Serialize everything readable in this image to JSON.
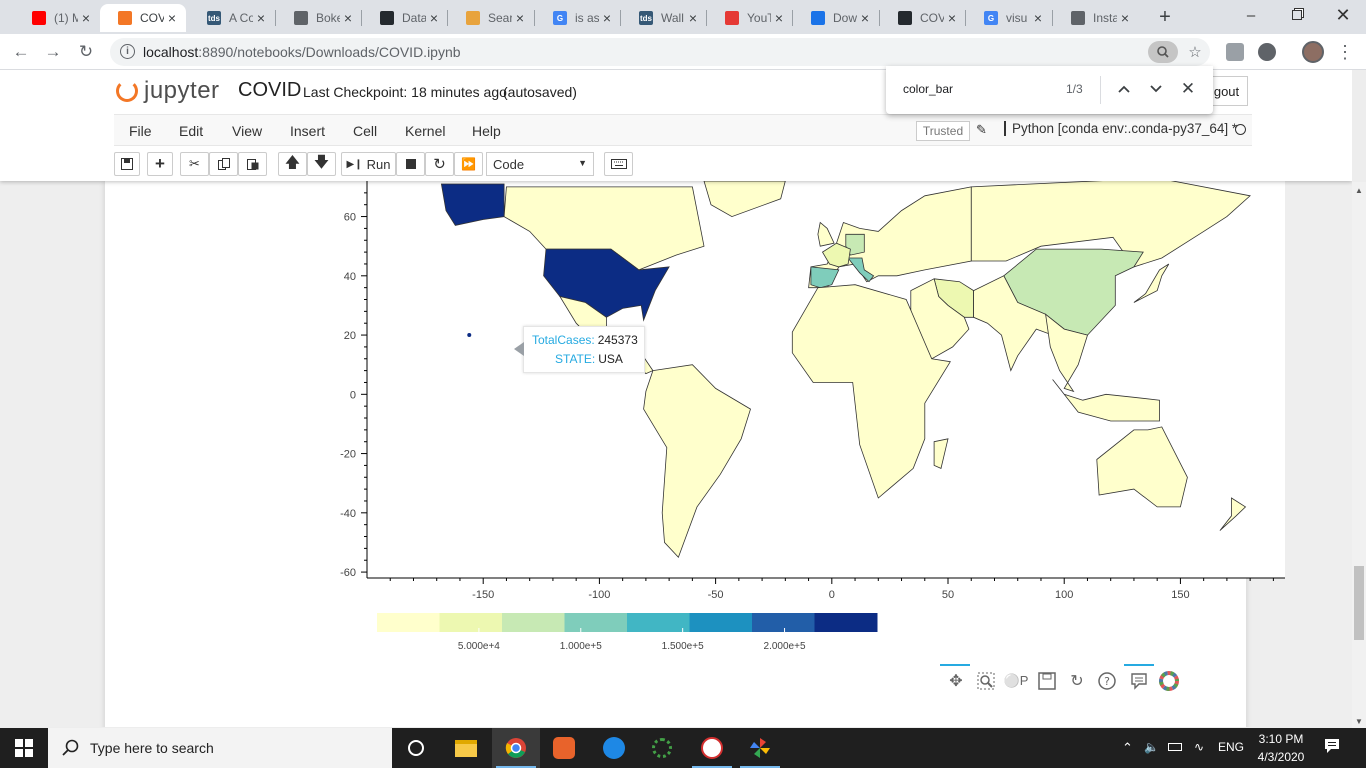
{
  "browser": {
    "tabs": [
      {
        "title": "(1) M",
        "favicon": "youtube-icon",
        "color": "#ff0000"
      },
      {
        "title": "COV",
        "favicon": "jupyter-icon",
        "color": "#f37726",
        "active": true
      },
      {
        "title": "A Co",
        "favicon": "tds-icon",
        "color": "#355876",
        "glyph": "tds"
      },
      {
        "title": "Boke",
        "favicon": "globe-icon",
        "color": "#5f6368"
      },
      {
        "title": "Data",
        "favicon": "github-icon",
        "color": "#24292e"
      },
      {
        "title": "Sear",
        "favicon": "pinwheel-icon",
        "color": "#e8a33d"
      },
      {
        "title": "is as",
        "favicon": "google-icon",
        "color": "#4285f4",
        "glyph": "G"
      },
      {
        "title": "Wall",
        "favicon": "tds-icon",
        "color": "#355876",
        "glyph": "tds"
      },
      {
        "title": "YouT",
        "favicon": "youtube-download-icon",
        "color": "#e53935"
      },
      {
        "title": "Dow",
        "favicon": "download-icon",
        "color": "#1a73e8"
      },
      {
        "title": "COV",
        "favicon": "github-icon",
        "color": "#24292e"
      },
      {
        "title": "visu",
        "favicon": "google-icon",
        "color": "#4285f4",
        "glyph": "G"
      },
      {
        "title": "Insta",
        "favicon": "globe-icon",
        "color": "#5f6368"
      }
    ],
    "url_host": "localhost",
    "url_path": ":8890/notebooks/Downloads/COVID.ipynb"
  },
  "find": {
    "query": "color_bar",
    "count": "1/3"
  },
  "jupyter": {
    "logo_text": "jupyter",
    "notebook_name": "COVID",
    "checkpoint": "Last Checkpoint: 18 minutes ago",
    "autosaved": "(autosaved)",
    "logout": "gout",
    "menus": [
      "File",
      "Edit",
      "View",
      "Insert",
      "Cell",
      "Kernel",
      "Help"
    ],
    "trusted": "Trusted",
    "kernel": "Python [conda env:.conda-py37_64] *",
    "run_label": "Run",
    "cell_type": "Code"
  },
  "tooltip": {
    "rows": [
      {
        "key": "TotalCases:",
        "value": "245373"
      },
      {
        "key": "STATE:",
        "value": "USA"
      }
    ]
  },
  "chart_data": {
    "type": "choropleth-map",
    "x_ticks": [
      "-150",
      "-100",
      "-50",
      "0",
      "50",
      "100",
      "150"
    ],
    "y_ticks": [
      "60",
      "40",
      "20",
      "0",
      "-20",
      "-40",
      "-60"
    ],
    "xlim": [
      -200,
      195
    ],
    "ylim": [
      -62,
      72
    ],
    "colorbar": {
      "palette": [
        "#ffffcc",
        "#edf8b1",
        "#c7e9b4",
        "#7fcdbb",
        "#41b6c4",
        "#1d91c0",
        "#225ea8",
        "#0c2c84"
      ],
      "range": [
        0,
        245373
      ],
      "tick_values": [
        50000,
        100000,
        150000,
        200000
      ],
      "tick_labels": [
        "5.000e+4",
        "1.000e+5",
        "1.500e+5",
        "2.000e+5"
      ]
    },
    "highlighted": {
      "STATE": "USA",
      "TotalCases": 245373
    }
  },
  "bokeh_tools": [
    "pan-icon",
    "box-zoom-icon",
    "wheel-zoom-icon",
    "save-icon",
    "reset-icon",
    "help-icon",
    "hover-icon",
    "bokeh-logo-icon"
  ],
  "taskbar": {
    "search_placeholder": "Type here to search",
    "time": "3:10 PM",
    "date": "4/3/2020",
    "lang": "ENG"
  }
}
